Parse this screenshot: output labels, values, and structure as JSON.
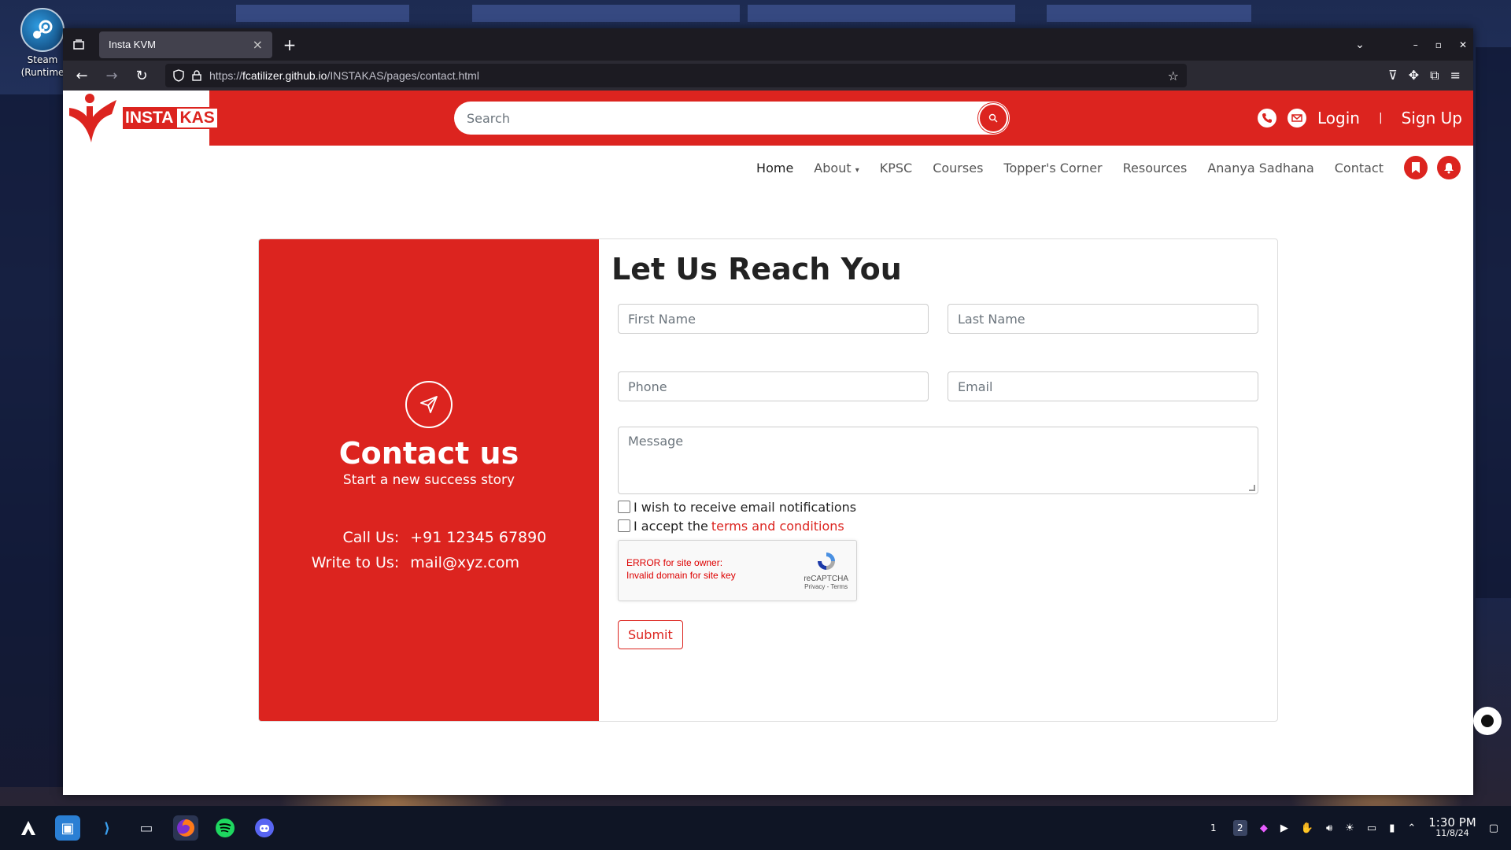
{
  "desktop": {
    "icon_label_1": "Steam",
    "icon_label_2": "(Runtime"
  },
  "browser": {
    "tab_title": "Insta KVM",
    "url_prefix": "https://",
    "url_host": "fcatilizer.github.io",
    "url_path": "/INSTAKAS/pages/contact.html"
  },
  "site": {
    "logo_part1": "INSTA",
    "logo_part2": "KAS",
    "search_placeholder": "Search",
    "login": "Login",
    "separator": "|",
    "signup": "Sign Up",
    "menu": [
      "Home",
      "About",
      "KPSC",
      "Courses",
      "Topper's Corner",
      "Resources",
      "Ananya Sadhana",
      "Contact"
    ],
    "brand_color": "#dc241f"
  },
  "contact": {
    "left_title": "Contact us",
    "left_subtitle": "Start a new success story",
    "call_label": "Call Us:",
    "call_value": "+91 12345 67890",
    "write_label": "Write to Us:",
    "write_value": "mail@xyz.com",
    "form_title": "Let Us Reach You",
    "first_name_placeholder": "First Name",
    "last_name_placeholder": "Last Name",
    "phone_placeholder": "Phone",
    "email_placeholder": "Email",
    "message_placeholder": "Message",
    "notify_label": "I wish to receive email notifications",
    "accept_prefix": "I accept the",
    "accept_link": "terms and conditions",
    "captcha_error_1": "ERROR for site owner:",
    "captcha_error_2": "Invalid domain for site key",
    "captcha_brand": "reCAPTCHA",
    "captcha_links": "Privacy - Terms",
    "submit_label": "Submit"
  },
  "taskbar": {
    "workspace_1": "1",
    "workspace_2": "2",
    "time": "1:30 PM",
    "date": "11/8/24"
  }
}
